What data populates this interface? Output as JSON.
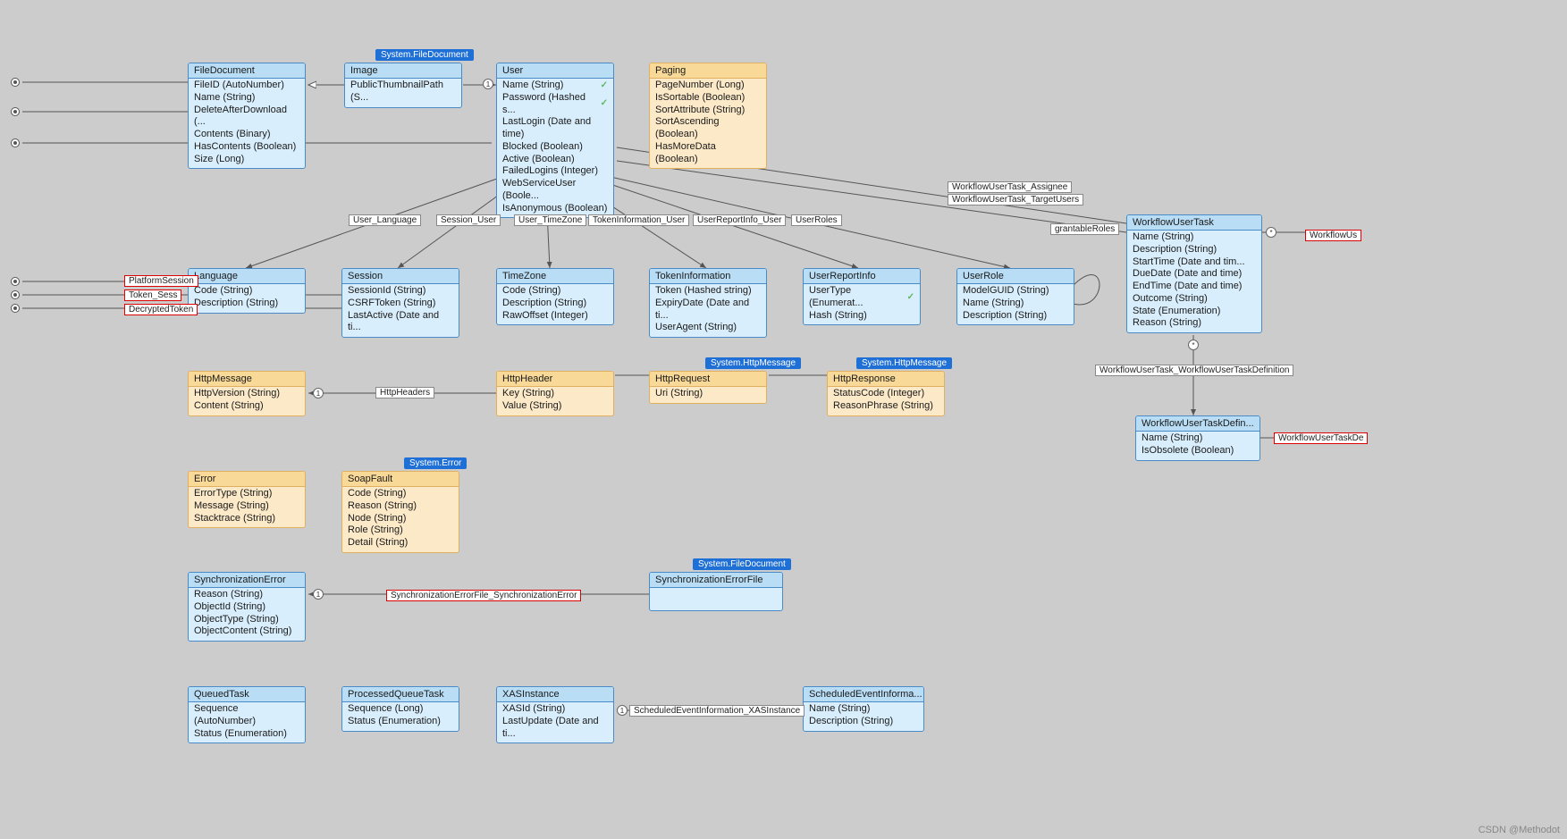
{
  "badges": {
    "system_filedocument_image": "System.FileDocument",
    "system_error": "System.Error",
    "system_httpmessage_req": "System.HttpMessage",
    "system_httpmessage_res": "System.HttpMessage",
    "system_filedocument_sync": "System.FileDocument"
  },
  "entities": {
    "filedocument": {
      "title": "FileDocument",
      "attrs": [
        "FileID (AutoNumber)",
        "Name (String)",
        "DeleteAfterDownload (...",
        "Contents (Binary)",
        "HasContents (Boolean)",
        "Size (Long)"
      ]
    },
    "image": {
      "title": "Image",
      "attrs": [
        "PublicThumbnailPath (S..."
      ]
    },
    "user": {
      "title": "User",
      "attrs_checked": [
        "Name (String)",
        "Password (Hashed s..."
      ],
      "attrs": [
        "LastLogin (Date and time)",
        "Blocked (Boolean)",
        "Active (Boolean)",
        "FailedLogins (Integer)",
        "WebServiceUser (Boole...",
        "IsAnonymous (Boolean)"
      ]
    },
    "paging": {
      "title": "Paging",
      "attrs": [
        "PageNumber (Long)",
        "IsSortable (Boolean)",
        "SortAttribute (String)",
        "SortAscending (Boolean)",
        "HasMoreData (Boolean)"
      ]
    },
    "language": {
      "title": "Language",
      "attrs": [
        "Code (String)",
        "Description (String)"
      ]
    },
    "session": {
      "title": "Session",
      "attrs": [
        "SessionId (String)",
        "CSRFToken (String)",
        "LastActive (Date and ti..."
      ]
    },
    "timezone": {
      "title": "TimeZone",
      "attrs": [
        "Code (String)",
        "Description (String)",
        "RawOffset (Integer)"
      ]
    },
    "tokeninformation": {
      "title": "TokenInformation",
      "attrs": [
        "Token (Hashed string)",
        "ExpiryDate (Date and ti...",
        "UserAgent (String)"
      ]
    },
    "userreportinfo": {
      "title": "UserReportInfo",
      "attrs_checked": [
        "UserType (Enumerat..."
      ],
      "attrs": [
        "Hash (String)"
      ]
    },
    "userrole": {
      "title": "UserRole",
      "attrs": [
        "ModelGUID (String)",
        "Name (String)",
        "Description (String)"
      ]
    },
    "workflowusertask": {
      "title": "WorkflowUserTask",
      "attrs": [
        "Name (String)",
        "Description (String)",
        "StartTime (Date and tim...",
        "DueDate (Date and time)",
        "EndTime (Date and time)",
        "Outcome (String)",
        "State (Enumeration)",
        "Reason (String)"
      ]
    },
    "httpmessage": {
      "title": "HttpMessage",
      "attrs": [
        "HttpVersion (String)",
        "Content (String)"
      ]
    },
    "httpheader": {
      "title": "HttpHeader",
      "attrs": [
        "Key (String)",
        "Value (String)"
      ]
    },
    "httprequest": {
      "title": "HttpRequest",
      "attrs": [
        "Uri (String)"
      ]
    },
    "httpresponse": {
      "title": "HttpResponse",
      "attrs": [
        "StatusCode (Integer)",
        "ReasonPhrase (String)"
      ]
    },
    "error": {
      "title": "Error",
      "attrs": [
        "ErrorType (String)",
        "Message (String)",
        "Stacktrace (String)"
      ]
    },
    "soapfault": {
      "title": "SoapFault",
      "attrs": [
        "Code (String)",
        "Reason (String)",
        "Node (String)",
        "Role (String)",
        "Detail (String)"
      ]
    },
    "syncerror": {
      "title": "SynchronizationError",
      "attrs": [
        "Reason (String)",
        "ObjectId (String)",
        "ObjectType (String)",
        "ObjectContent (String)"
      ]
    },
    "syncerrorfile": {
      "title": "SynchronizationErrorFile",
      "attrs": []
    },
    "workflowusertaskdef": {
      "title": "WorkflowUserTaskDefin...",
      "attrs": [
        "Name (String)",
        "IsObsolete (Boolean)"
      ]
    },
    "queuedtask": {
      "title": "QueuedTask",
      "attrs": [
        "Sequence (AutoNumber)",
        "Status (Enumeration)"
      ]
    },
    "processedqueuetask": {
      "title": "ProcessedQueueTask",
      "attrs": [
        "Sequence (Long)",
        "Status (Enumeration)"
      ]
    },
    "xasinstance": {
      "title": "XASInstance",
      "attrs": [
        "XASId (String)",
        "LastUpdate (Date and ti..."
      ]
    },
    "scheduledeventinfo": {
      "title": "ScheduledEventInforma...",
      "attrs": [
        "Name (String)",
        "Description (String)"
      ]
    }
  },
  "assoc_labels": {
    "platformsession": "PlatformSession",
    "token_sess": "Token_Sess",
    "decryptedtoken": "DecryptedToken",
    "user_language": "User_Language",
    "session_user": "Session_User",
    "user_timezone": "User_TimeZone",
    "tokeninformation_user": "TokenInformation_User",
    "userreportinfo_user": "UserReportInfo_User",
    "userroles": "UserRoles",
    "grantableroles": "grantableRoles",
    "workflowusertask_assignee": "WorkflowUserTask_Assignee",
    "workflowusertask_targetusers": "WorkflowUserTask_TargetUsers",
    "httpheaders": "HttpHeaders",
    "syncerrorfile_syncerror": "SynchronizationErrorFile_SynchronizationError",
    "workflowusertask_def": "WorkflowUserTask_WorkflowUserTaskDefinition",
    "scheduledeventinfo_xas": "ScheduledEventInformation_XASInstance",
    "workflowus": "WorkflowUs",
    "workflowusertaskde": "WorkflowUserTaskDe"
  },
  "watermark": "CSDN @Methodot"
}
